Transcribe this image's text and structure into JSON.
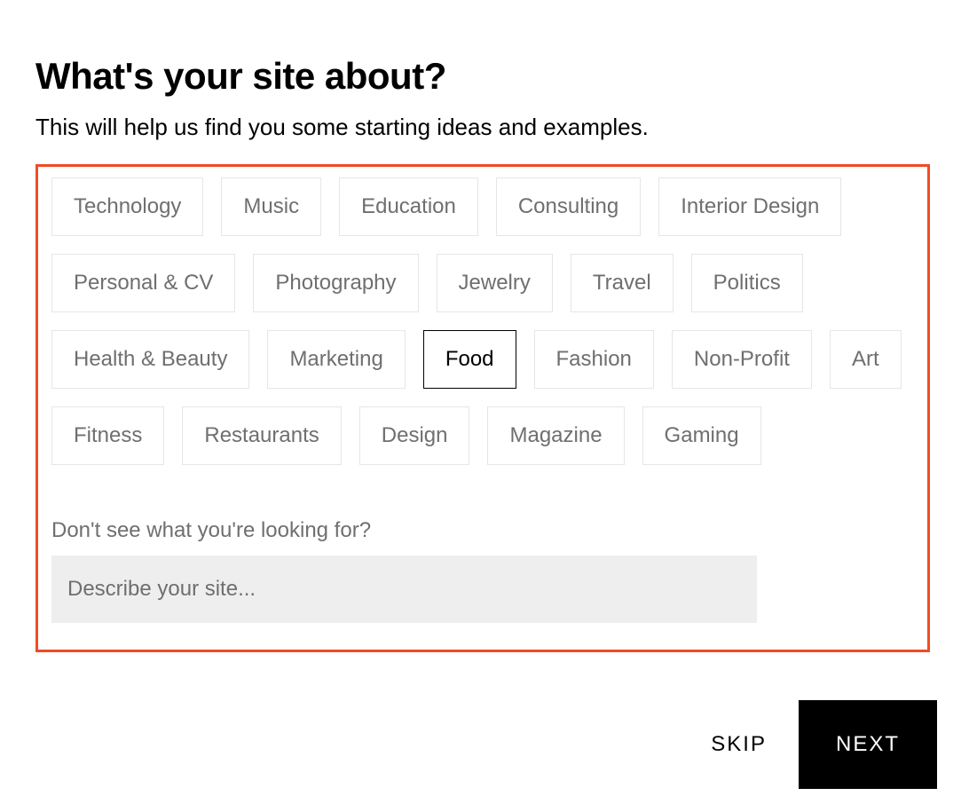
{
  "heading": "What's your site about?",
  "subheading": "This will help us find you some starting ideas and examples.",
  "topics": [
    {
      "label": "Technology",
      "selected": false
    },
    {
      "label": "Music",
      "selected": false
    },
    {
      "label": "Education",
      "selected": false
    },
    {
      "label": "Consulting",
      "selected": false
    },
    {
      "label": "Interior Design",
      "selected": false
    },
    {
      "label": "Personal & CV",
      "selected": false
    },
    {
      "label": "Photography",
      "selected": false
    },
    {
      "label": "Jewelry",
      "selected": false
    },
    {
      "label": "Travel",
      "selected": false
    },
    {
      "label": "Politics",
      "selected": false
    },
    {
      "label": "Health & Beauty",
      "selected": false
    },
    {
      "label": "Marketing",
      "selected": false
    },
    {
      "label": "Food",
      "selected": true
    },
    {
      "label": "Fashion",
      "selected": false
    },
    {
      "label": "Non-Profit",
      "selected": false
    },
    {
      "label": "Art",
      "selected": false
    },
    {
      "label": "Fitness",
      "selected": false
    },
    {
      "label": "Restaurants",
      "selected": false
    },
    {
      "label": "Design",
      "selected": false
    },
    {
      "label": "Magazine",
      "selected": false
    },
    {
      "label": "Gaming",
      "selected": false
    }
  ],
  "prompt": {
    "label": "Don't see what you're looking for?",
    "placeholder": "Describe your site..."
  },
  "actions": {
    "skip": "SKIP",
    "next": "NEXT"
  },
  "colors": {
    "highlight_border": "#f04c23",
    "pill_border": "#e6e6e6",
    "pill_text": "#6f6f6f",
    "selected_border": "#000000",
    "input_bg": "#eeeeee",
    "next_bg": "#000000"
  }
}
